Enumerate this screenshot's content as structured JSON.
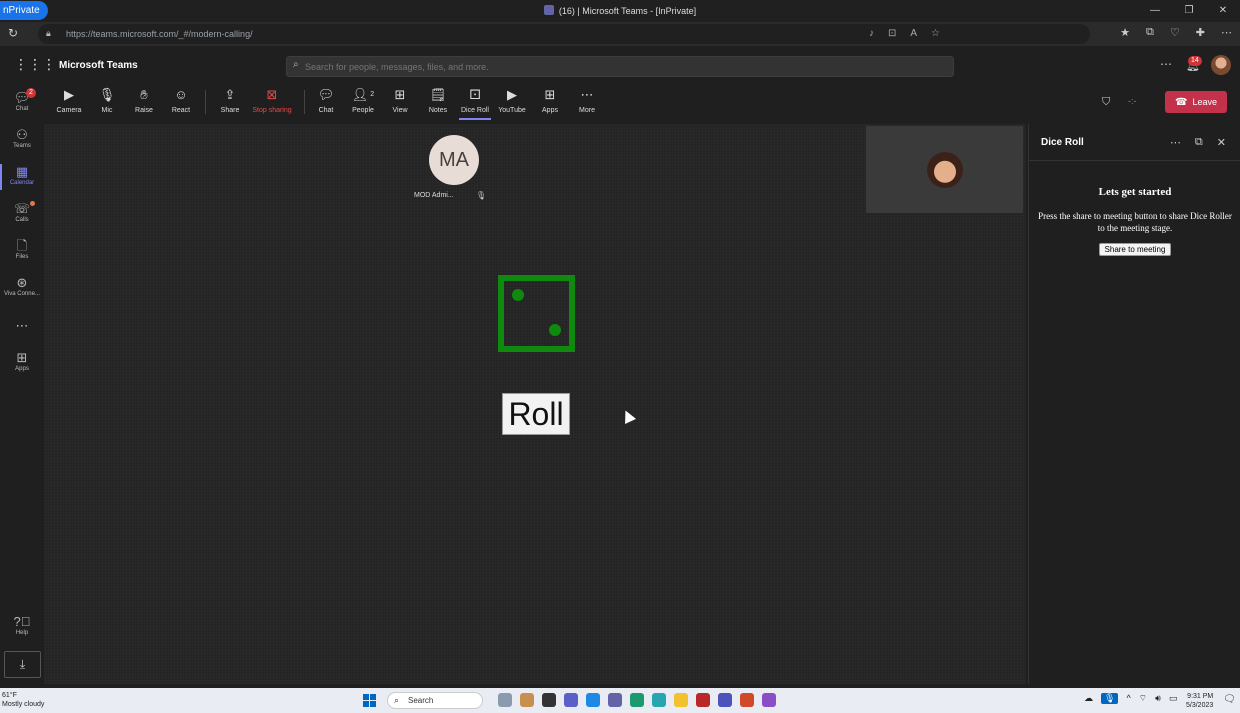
{
  "browser": {
    "mode_badge": "nPrivate",
    "tab_title": "(16) | Microsoft Teams - [InPrivate]",
    "url": "https://teams.microsoft.com/_#/modern-calling/",
    "window_controls": {
      "minimize": "—",
      "restore": "❐",
      "close": "✕"
    }
  },
  "teams": {
    "app_name": "Microsoft Teams",
    "search_placeholder": "Search for people, messages, files, and more.",
    "notification_count": "14"
  },
  "rail": {
    "items": [
      {
        "label": "Chat",
        "icon": "chat-icon",
        "badge": "2"
      },
      {
        "label": "Teams",
        "icon": "teams-icon"
      },
      {
        "label": "Calendar",
        "icon": "calendar-icon",
        "active": true
      },
      {
        "label": "Calls",
        "icon": "calls-icon"
      },
      {
        "label": "Files",
        "icon": "files-icon"
      },
      {
        "label": "Viva Conne...",
        "icon": "viva-icon"
      },
      {
        "label": "Apps",
        "icon": "apps-icon"
      },
      {
        "label": "Help",
        "icon": "help-icon"
      }
    ]
  },
  "toolbar": {
    "camera": "Camera",
    "mic": "Mic",
    "raise": "Raise",
    "react": "React",
    "share": "Share",
    "stop_sharing": "Stop sharing",
    "chat": "Chat",
    "people": "People",
    "people_count": "2",
    "view": "View",
    "notes": "Notes",
    "dice_roll": "Dice Roll",
    "youtube": "YouTube",
    "apps": "Apps",
    "more": "More",
    "timer": "-:-",
    "leave": "Leave"
  },
  "stage": {
    "participant_initials": "MA",
    "participant_name": "MOD Admi...",
    "die_value": 2,
    "roll_label": "Roll"
  },
  "panel": {
    "title": "Dice Roll",
    "heading": "Lets get started",
    "description": "Press the share to meeting button to share Dice Roller to the meeting stage.",
    "share_button": "Share to meeting"
  },
  "taskbar": {
    "temperature": "61°F",
    "weather": "Mostly cloudy",
    "search": "Search",
    "time": "9:31 PM",
    "date": "5/3/2023"
  }
}
